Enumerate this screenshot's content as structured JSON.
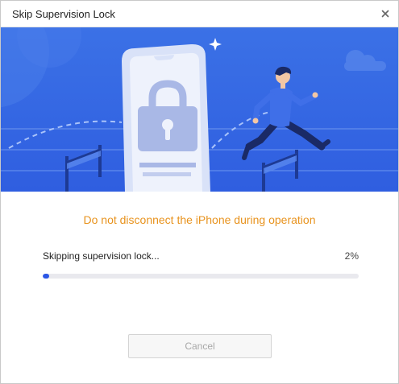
{
  "window": {
    "title": "Skip Supervision Lock",
    "close_icon": "close-icon"
  },
  "banner": {
    "illustration": "phone-padlock-hurdle-runner",
    "colors": {
      "sky_top": "#3b71e6",
      "sky_bottom": "#2f5ee0",
      "phone": "#d9e2f8",
      "padlock": "#a9b8e6",
      "runner_shirt": "#3f6fe8"
    }
  },
  "main": {
    "warning": "Do not disconnect the iPhone during operation",
    "warning_color": "#e8931e",
    "progress": {
      "label": "Skipping supervision lock...",
      "percent_text": "2%",
      "value": 0.02,
      "color": "#2c57e6"
    },
    "cancel_label": "Cancel"
  }
}
